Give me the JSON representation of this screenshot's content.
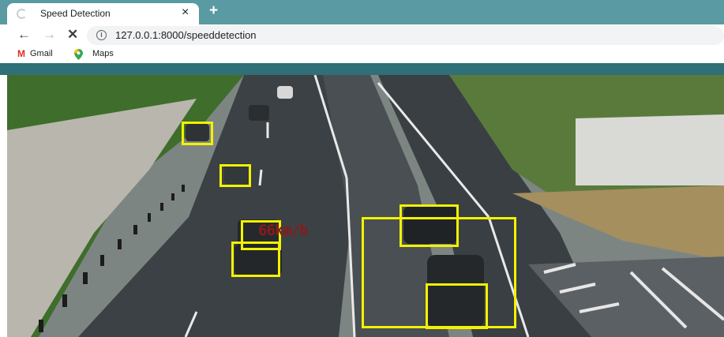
{
  "browser": {
    "tab": {
      "title": "Speed Detection",
      "close_glyph": "×"
    },
    "new_tab_glyph": "+",
    "nav": {
      "back": "←",
      "forward": "→",
      "stop": "✕"
    },
    "address": {
      "url": "127.0.0.1:8000/speeddetection",
      "info_glyph": "i"
    },
    "bookmarks": [
      {
        "label": "Gmail",
        "icon": "gmail-icon",
        "glyph": "M",
        "color": "#d93025"
      },
      {
        "label": "Maps",
        "icon": "maps-pin-icon",
        "glyph": "⬤",
        "color": "#34a853"
      }
    ],
    "tabstrip_color": "#5a9aa2",
    "banner_color": "#2f6f77"
  },
  "video": {
    "box_color": "#f2f200",
    "speed_text": "66km/h",
    "speed_color": "#8b1a1a"
  }
}
